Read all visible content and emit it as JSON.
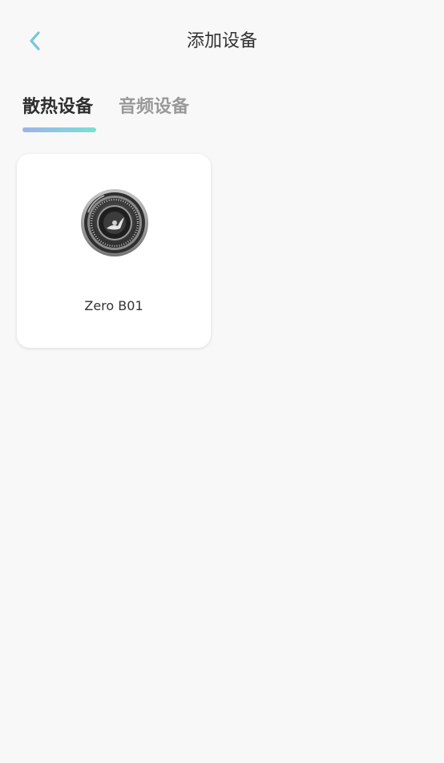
{
  "header": {
    "title": "添加设备",
    "back_icon": "chevron-left-icon",
    "accent_color": "#7cc7d9"
  },
  "tabs": [
    {
      "label": "散热设备",
      "active": true
    },
    {
      "label": "音频设备",
      "active": false
    }
  ],
  "tab_indicator_colors": [
    "#9eb3e8",
    "#79e0d7"
  ],
  "devices": [
    {
      "name": "Zero B01",
      "icon": "fan-device-icon"
    }
  ]
}
